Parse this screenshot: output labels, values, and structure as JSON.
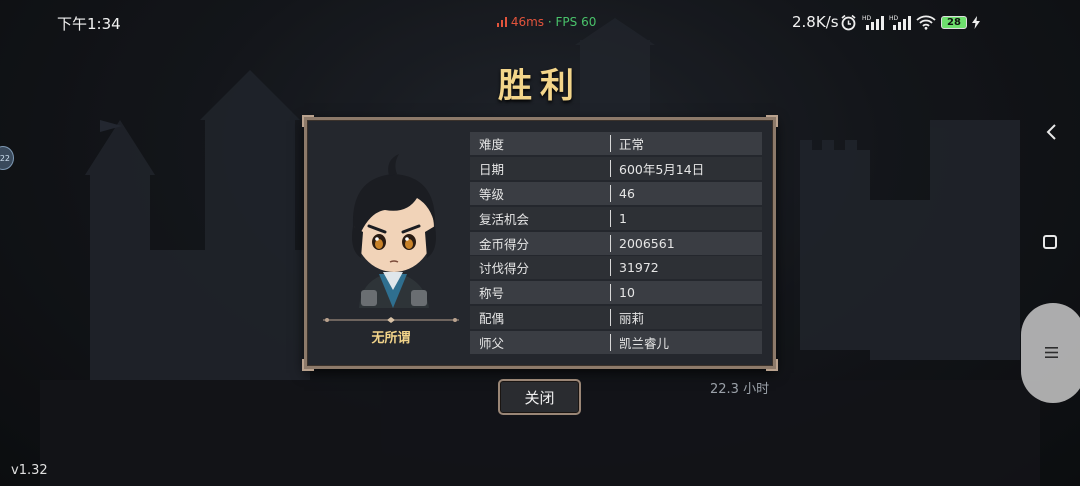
{
  "status_bar": {
    "time": "下午1:34",
    "ping": "46ms",
    "separator": "·",
    "fps": "FPS 60",
    "net_speed": "2.8K/s",
    "battery": "28",
    "icons": [
      "alarm-icon",
      "signal-hd-icon",
      "signal-hd-icon",
      "wifi-icon",
      "battery-icon",
      "charging-icon"
    ]
  },
  "edge_badge": "22",
  "title": "胜利",
  "hero": {
    "name": "无所谓"
  },
  "stats": [
    {
      "label": "难度",
      "value": "正常"
    },
    {
      "label": "日期",
      "value": "600年5月14日"
    },
    {
      "label": "等级",
      "value": "46"
    },
    {
      "label": "复活机会",
      "value": "1"
    },
    {
      "label": "金币得分",
      "value": "2006561"
    },
    {
      "label": "讨伐得分",
      "value": "31972"
    },
    {
      "label": "称号",
      "value": "10"
    },
    {
      "label": "配偶",
      "value": "丽莉"
    },
    {
      "label": "师父",
      "value": "凯兰睿儿"
    }
  ],
  "close_label": "关闭",
  "playtime": "22.3 小时",
  "version": "v1.32",
  "colors": {
    "title": "#f3d58a",
    "panel_border": "#8d7a6a",
    "ping": "#e3543c",
    "fps": "#49c26a"
  }
}
